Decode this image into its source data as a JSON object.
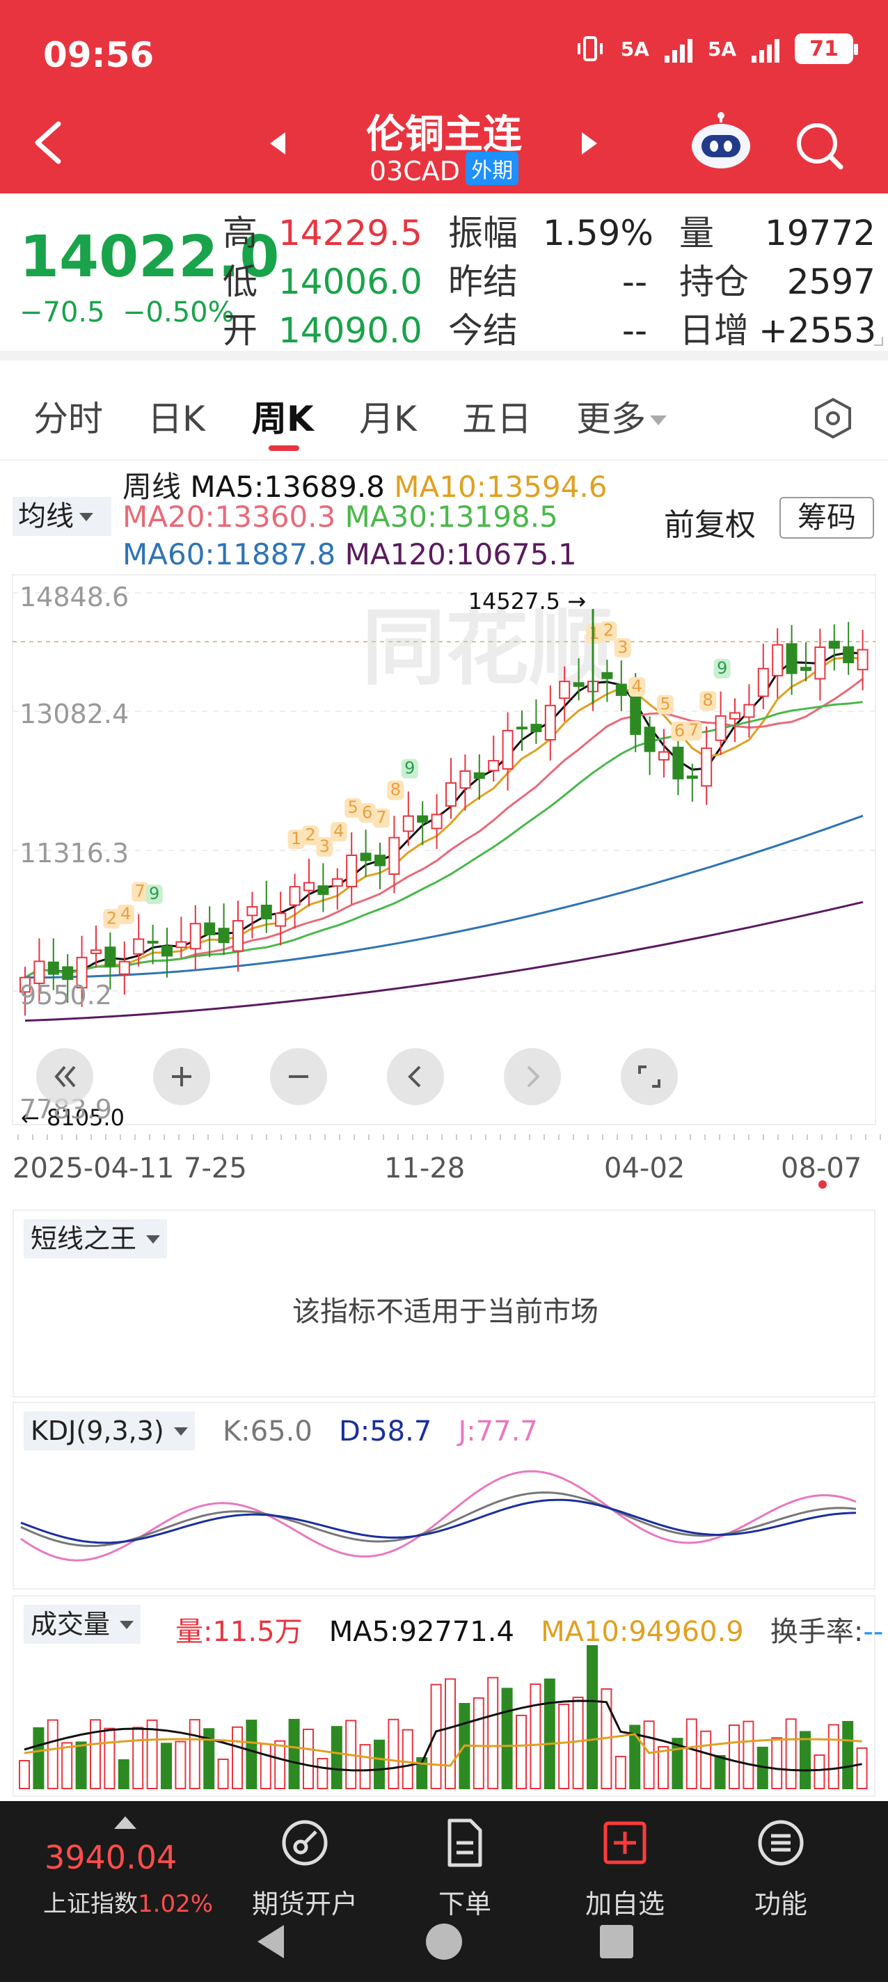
{
  "status": {
    "time": "09:56",
    "net1": "5A",
    "net2": "5A",
    "battery": "71"
  },
  "header": {
    "title": "伦铜主连",
    "code": "03CAD",
    "badge": "外期"
  },
  "quote": {
    "price": "14022.0",
    "change": "−70.5",
    "change_pct": "−0.50%",
    "rows": [
      {
        "l1": "高",
        "v1": "14229.5",
        "l2": "振幅",
        "v2": "1.59%",
        "l3": "量",
        "v3": "19772"
      },
      {
        "l1": "低",
        "v1": "14006.0",
        "l2": "昨结",
        "v2": "--",
        "l3": "持仓",
        "v3": "2597"
      },
      {
        "l1": "开",
        "v1": "14090.0",
        "l2": "今结",
        "v2": "--",
        "l3": "日增",
        "v3": "+2553"
      }
    ]
  },
  "tabs": [
    "分时",
    "日K",
    "周K",
    "月K",
    "五日",
    "更多"
  ],
  "active_tab": "周K",
  "ma_legend": {
    "prefix": "周线",
    "ma5": "MA5:13689.8",
    "ma10": "MA10:13594.6",
    "ma20": "MA20:13360.3",
    "ma30": "MA30:13198.5",
    "ma60": "MA60:11887.8",
    "ma120": "MA120:10675.1",
    "avg_btn": "均线",
    "fq_label": "前复权",
    "chip_btn": "筹码"
  },
  "colors": {
    "up": "#e8343f",
    "down": "#2d8a22",
    "ma5": "#111111",
    "ma10": "#e0a020",
    "ma20": "#e86a78",
    "ma30": "#49b84a",
    "ma60": "#2e74b5",
    "ma120": "#5a1a5e",
    "k": "#777777",
    "d": "#1a2e9e",
    "j": "#e878c0"
  },
  "chart_data": {
    "type": "candlestick",
    "yticks": [
      "14848.6",
      "13082.4",
      "11316.3",
      "9550.2",
      "7783.9"
    ],
    "ylim": [
      7783.9,
      14848.6
    ],
    "high_label": "14527.5",
    "low_label": "8105.0",
    "xticks": [
      "2025-04-11",
      "7-25",
      "11-28",
      "04-02",
      "08-07"
    ],
    "signal_labels": [
      "1",
      "2",
      "3",
      "4",
      "5",
      "6",
      "7",
      "8",
      "9",
      "1",
      "2",
      "3",
      "4",
      "5",
      "6",
      "7",
      "8",
      "9",
      "1",
      "2",
      "3",
      "4",
      "5",
      "6",
      "7",
      "8",
      "9"
    ]
  },
  "panel_short": {
    "tag": "短线之王",
    "message": "该指标不适用于当前市场"
  },
  "panel_kdj": {
    "tag": "KDJ(9,3,3)",
    "k": "K:65.0",
    "d": "D:58.7",
    "j": "J:77.7"
  },
  "panel_vol": {
    "tag": "成交量",
    "vol": "量:11.5万",
    "ma5": "MA5:92771.4",
    "ma10": "MA10:94960.9",
    "turnover_label": "换手率:",
    "turnover_value": "--"
  },
  "bottom_nav": {
    "index_value": "3940.04",
    "index_name": "上证指数",
    "index_pct": "1.02%",
    "items": [
      "期货开户",
      "下单",
      "加自选",
      "功能"
    ]
  }
}
